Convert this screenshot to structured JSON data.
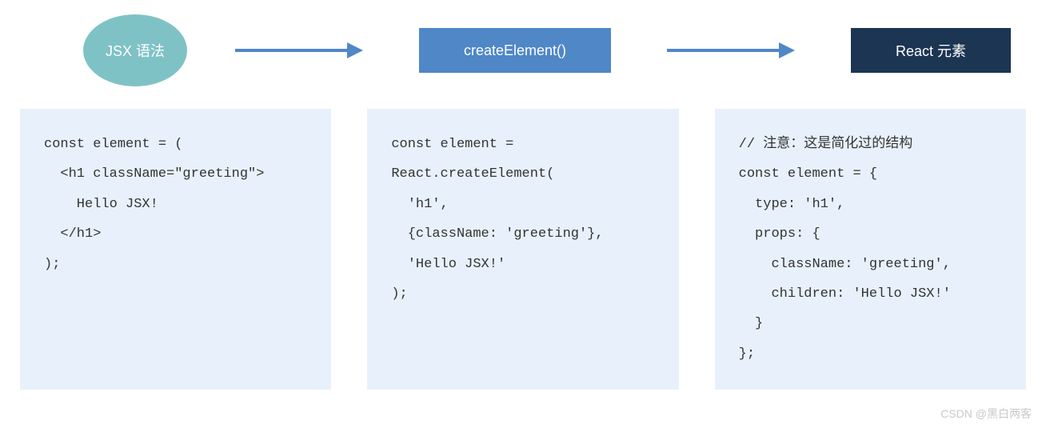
{
  "flow": {
    "node1": "JSX 语法",
    "node2": "createElement()",
    "node3": "React 元素"
  },
  "code": {
    "block1": "const element = (\n  <h1 className=\"greeting\">\n    Hello JSX!\n  </h1>\n);",
    "block2": "const element = \nReact.createElement(\n  'h1',\n  {className: 'greeting'},\n  'Hello JSX!'\n);",
    "block3": "// 注意：这是简化过的结构\nconst element = {\n  type: 'h1',\n  props: {\n    className: 'greeting',\n    children: 'Hello JSX!'\n  }\n};"
  },
  "watermark": "CSDN @黑白两客",
  "colors": {
    "circle": "#7fc2c6",
    "rectBlue": "#4f87c7",
    "rectDark": "#1c3553",
    "arrow": "#4f87c7",
    "codeBg": "#e8f1fb"
  }
}
